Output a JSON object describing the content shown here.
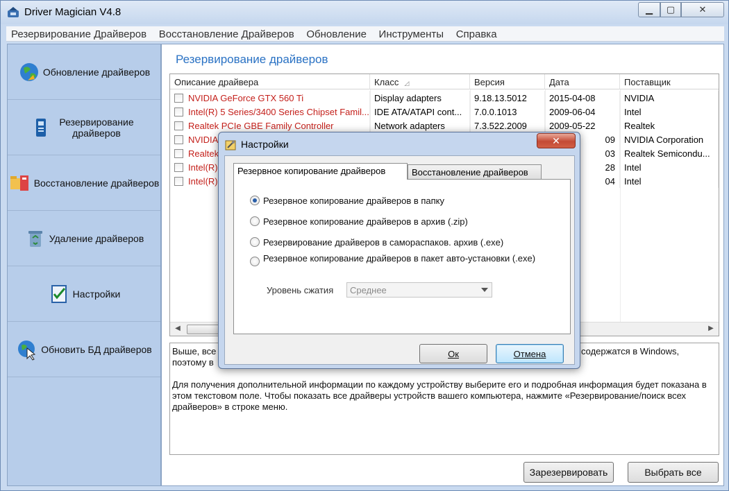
{
  "app": {
    "title": "Driver Magician V4.8"
  },
  "menu": [
    "Резервирование Драйверов",
    "Восстановление Драйверов",
    "Обновление",
    "Инструменты",
    "Справка"
  ],
  "sidebar": {
    "items": [
      {
        "label": "Обновление драйверов",
        "icon": "globe-update-icon"
      },
      {
        "label": "Резервирование драйверов",
        "icon": "backup-device-icon"
      },
      {
        "label": "Восстановление драйверов",
        "icon": "restore-folder-icon"
      },
      {
        "label": "Удаление драйверов",
        "icon": "recycle-bin-icon"
      },
      {
        "label": "Настройки",
        "icon": "settings-checklist-icon"
      },
      {
        "label": "Обновить БД драйверов",
        "icon": "globe-cursor-icon"
      }
    ]
  },
  "main": {
    "title": "Резервирование драйверов",
    "columns": [
      "Описание драйвера",
      "Класс",
      "Версия",
      "Дата",
      "Поставщик"
    ],
    "rows": [
      {
        "desc": "NVIDIA GeForce GTX 560 Ti",
        "class": "Display adapters",
        "version": "9.18.13.5012",
        "date": "2015-04-08",
        "vendor": "NVIDIA"
      },
      {
        "desc": "Intel(R) 5 Series/3400 Series Chipset Famil...",
        "class": "IDE ATA/ATAPI cont...",
        "version": "7.0.0.1013",
        "date": "2009-06-04",
        "vendor": "Intel"
      },
      {
        "desc": "Realtek PCIe GBE Family Controller",
        "class": "Network adapters",
        "version": "7.3.522.2009",
        "date": "2009-05-22",
        "vendor": "Realtek"
      },
      {
        "desc": "NVIDIA",
        "class": "",
        "version": "",
        "date": "09",
        "vendor": "NVIDIA Corporation"
      },
      {
        "desc": "Realtek",
        "class": "",
        "version": "",
        "date": "03",
        "vendor": "Realtek Semicondu..."
      },
      {
        "desc": "Intel(R)",
        "class": "",
        "version": "",
        "date": "28",
        "vendor": "Intel"
      },
      {
        "desc": "Intel(R)",
        "class": "",
        "version": "",
        "date": "04",
        "vendor": "Intel"
      }
    ],
    "info": {
      "p1_a": "Выше, все",
      "p1_b": "содержатся в Windows,",
      "p1_c": "поэтому в",
      "p2": "Для получения дополнительной информации по каждому устройству выберите его и подробная информация будет показана в этом текстовом поле. Чтобы показать все драйверы устройств вашего компьютера, нажмите «Резервирование/поиск всех драйверов» в строке меню."
    },
    "buttons": {
      "backup": "Зарезервировать",
      "select_all": "Выбрать все"
    }
  },
  "dialog": {
    "title": "Настройки",
    "close": "✕",
    "tabs": [
      "Резервное копирование драйверов",
      "Восстановление драйверов"
    ],
    "options": [
      {
        "label": "Резервное копирование драйверов в папку",
        "selected": true
      },
      {
        "label": "Резервное копирование драйверов в архив (.zip)",
        "selected": false
      },
      {
        "label": "Резервирование драйверов в самораспаков. архив (.exe)",
        "selected": false
      },
      {
        "label": "Резервное копирование драйверов в пакет авто-установки (.exe)",
        "selected": false
      }
    ],
    "compression_label": "Уровень сжатия",
    "compression_value": "Среднее",
    "ok": "Ок",
    "cancel": "Отмена"
  }
}
